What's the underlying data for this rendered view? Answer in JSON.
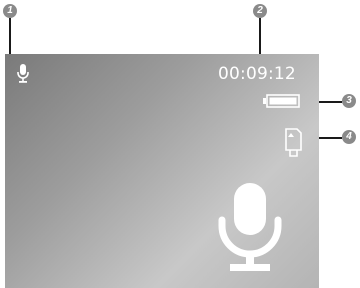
{
  "callouts": [
    "1",
    "2",
    "3",
    "4"
  ],
  "status": {
    "recording_time": "00:09:12",
    "mic_indicator_icon": "microphone-icon",
    "battery_icon": "battery-full-icon",
    "battery_level": 1.0,
    "storage_icon": "sd-card-icon"
  },
  "main": {
    "watermark_icon": "microphone-icon"
  },
  "colors": {
    "screen_gradient": [
      "#7a7a7a",
      "#c8c8c8"
    ],
    "icon": "#ffffff",
    "callout": "#8a8a8a",
    "leader_line": "#1a1a1a"
  }
}
